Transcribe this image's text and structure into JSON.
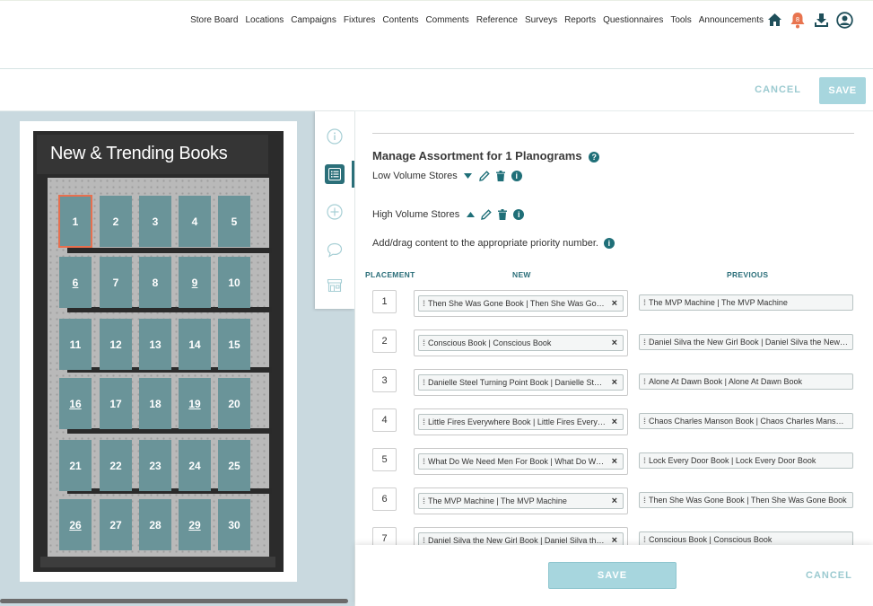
{
  "nav": {
    "links": [
      "Store Board",
      "Locations",
      "Campaigns",
      "Fixtures",
      "Contents",
      "Comments",
      "Reference",
      "Surveys",
      "Reports",
      "Questionnaires",
      "Tools",
      "Announcements"
    ],
    "notification_count": "8"
  },
  "actions": {
    "cancel_label": "CANCEL",
    "save_label": "SAVE"
  },
  "fixture": {
    "title": "New & Trending Books",
    "positions": [
      "1",
      "2",
      "3",
      "4",
      "5",
      "6",
      "7",
      "8",
      "9",
      "10",
      "11",
      "12",
      "13",
      "14",
      "15",
      "16",
      "17",
      "18",
      "19",
      "20",
      "21",
      "22",
      "23",
      "24",
      "25",
      "26",
      "27",
      "28",
      "29",
      "30"
    ],
    "selected": "1"
  },
  "panel": {
    "title": "Manage Assortment for 1 Planograms",
    "groups": [
      {
        "name": "Low Volume Stores",
        "expanded": false
      },
      {
        "name": "High Volume Stores",
        "expanded": true
      }
    ],
    "instruction": "Add/drag content to the appropriate priority number.",
    "columns": {
      "placement": "PLACEMENT",
      "new": "NEW",
      "previous": "PREVIOUS"
    },
    "rows": [
      {
        "placement": "1",
        "new": "Then She Was Gone Book | Then She Was Gone Book",
        "previous": "The MVP Machine | The MVP Machine"
      },
      {
        "placement": "2",
        "new": "Conscious Book | Conscious Book",
        "previous": "Daniel Silva the New Girl Book | Daniel Silva the New Girl Book"
      },
      {
        "placement": "3",
        "new": "Danielle Steel Turning Point Book | Danielle Steel Turning Point Book",
        "previous": "Alone At Dawn Book | Alone At Dawn Book"
      },
      {
        "placement": "4",
        "new": "Little Fires Everywhere Book | Little Fires Everywhere Book",
        "previous": "Chaos Charles Manson Book | Chaos Charles Manson Book"
      },
      {
        "placement": "5",
        "new": "What Do We Need Men For Book | What Do We Need Men For Book",
        "previous": "Lock Every Door Book | Lock Every Door Book"
      },
      {
        "placement": "6",
        "new": "The MVP Machine | The MVP Machine",
        "previous": "Then She Was Gone Book | Then She Was Gone Book"
      },
      {
        "placement": "7",
        "new": "Daniel Silva the New Girl Book | Daniel Silva the New Girl Book",
        "previous": "Conscious Book | Conscious Book"
      }
    ]
  },
  "footer": {
    "save_label": "SAVE",
    "cancel_label": "CANCEL"
  },
  "colors": {
    "accent": "#1f6f78",
    "book": "#6a9499",
    "disabled_button": "#a7d6de",
    "selection": "#e7704f",
    "notification": "#e8744f"
  }
}
